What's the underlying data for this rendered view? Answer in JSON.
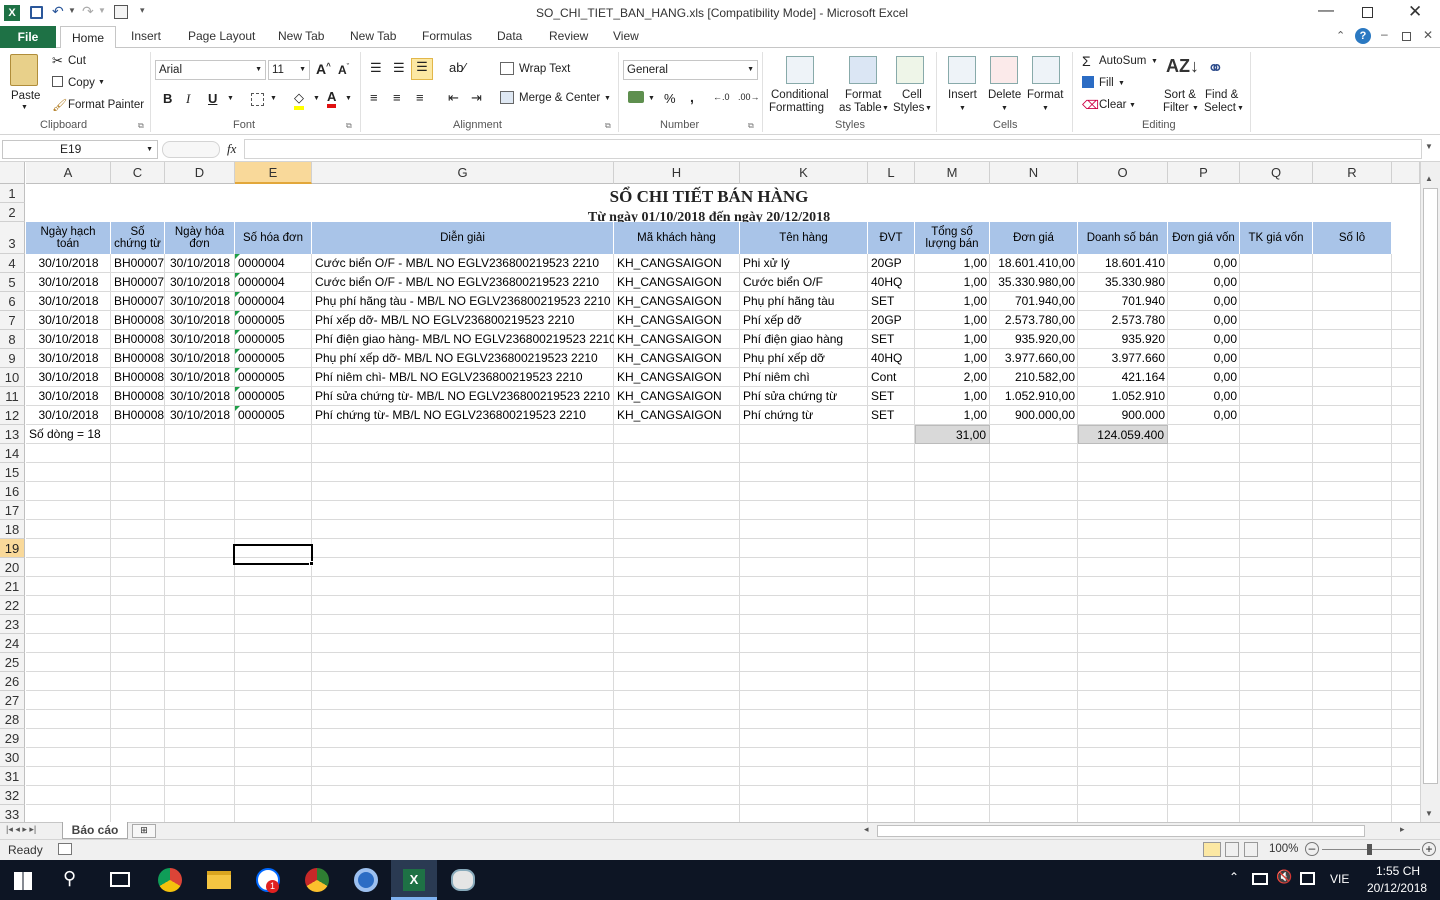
{
  "window": {
    "title": "SO_CHI_TIET_BAN_HANG.xls  [Compatibility Mode]  -  Microsoft Excel"
  },
  "tabs": [
    "File",
    "Home",
    "Insert",
    "Page Layout",
    "New Tab",
    "New Tab",
    "Formulas",
    "Data",
    "Review",
    "View"
  ],
  "ribbon": {
    "clipboard": {
      "label": "Clipboard",
      "paste": "Paste",
      "cut": "Cut",
      "copy": "Copy",
      "format_painter": "Format Painter"
    },
    "font": {
      "label": "Font",
      "name": "Arial",
      "size": "11"
    },
    "alignment": {
      "label": "Alignment",
      "wrap": "Wrap Text",
      "merge": "Merge & Center"
    },
    "number": {
      "label": "Number",
      "format": "General"
    },
    "styles": {
      "label": "Styles",
      "conditional1": "Conditional",
      "conditional2": "Formatting",
      "fmt_table1": "Format",
      "fmt_table2": "as Table",
      "cell_styles1": "Cell",
      "cell_styles2": "Styles"
    },
    "cells": {
      "label": "Cells",
      "insert": "Insert",
      "delete": "Delete",
      "format": "Format"
    },
    "editing": {
      "label": "Editing",
      "autosum": "AutoSum",
      "fill": "Fill",
      "clear": "Clear",
      "sort1": "Sort &",
      "sort2": "Filter",
      "find1": "Find &",
      "find2": "Select"
    }
  },
  "formula_bar": {
    "name_box": "E19",
    "fx": "fx",
    "formula": ""
  },
  "columns": [
    "A",
    "C",
    "D",
    "E",
    "G",
    "H",
    "K",
    "L",
    "M",
    "N",
    "O",
    "P",
    "Q",
    "R"
  ],
  "sheet": {
    "title": "SỔ CHI TIẾT BÁN HÀNG",
    "subtitle": "Từ ngày 01/10/2018 đến ngày 20/12/2018",
    "headers": [
      "Ngày hạch toán",
      "Số chứng từ",
      "Ngày hóa đơn",
      "Số hóa đơn",
      "Diễn giải",
      "Mã khách hàng",
      "Tên hàng",
      "ĐVT",
      "Tổng số lượng bán",
      "Đơn giá",
      "Doanh số bán",
      "Đơn giá vốn",
      "TK giá vốn",
      "Số lô"
    ],
    "rows": [
      [
        "30/10/2018",
        "BH00007",
        "30/10/2018",
        "0000004",
        "Cước biển O/F - MB/L NO EGLV236800219523 2210",
        "KH_CANGSAIGON",
        "Phi xử lý",
        "20GP",
        "1,00",
        "18.601.410,00",
        "18.601.410",
        "0,00"
      ],
      [
        "30/10/2018",
        "BH00007",
        "30/10/2018",
        "0000004",
        "Cước biển O/F - MB/L NO EGLV236800219523 2210",
        "KH_CANGSAIGON",
        "Cước biển O/F",
        "40HQ",
        "1,00",
        "35.330.980,00",
        "35.330.980",
        "0,00"
      ],
      [
        "30/10/2018",
        "BH00007",
        "30/10/2018",
        "0000004",
        "Phụ phí hãng tàu - MB/L NO EGLV236800219523 2210",
        "KH_CANGSAIGON",
        "Phụ phí hãng tàu",
        "SET",
        "1,00",
        "701.940,00",
        "701.940",
        "0,00"
      ],
      [
        "30/10/2018",
        "BH00008",
        "30/10/2018",
        "0000005",
        "Phí xếp dỡ- MB/L NO EGLV236800219523 2210",
        "KH_CANGSAIGON",
        "Phí xếp dỡ",
        "20GP",
        "1,00",
        "2.573.780,00",
        "2.573.780",
        "0,00"
      ],
      [
        "30/10/2018",
        "BH00008",
        "30/10/2018",
        "0000005",
        "Phí điện giao hàng- MB/L NO EGLV236800219523 2210",
        "KH_CANGSAIGON",
        "Phí điện giao hàng",
        "SET",
        "1,00",
        "935.920,00",
        "935.920",
        "0,00"
      ],
      [
        "30/10/2018",
        "BH00008",
        "30/10/2018",
        "0000005",
        "Phụ phí xếp dỡ- MB/L NO EGLV236800219523 2210",
        "KH_CANGSAIGON",
        "Phụ phí xếp dỡ",
        "40HQ",
        "1,00",
        "3.977.660,00",
        "3.977.660",
        "0,00"
      ],
      [
        "30/10/2018",
        "BH00008",
        "30/10/2018",
        "0000005",
        "Phí niêm chì- MB/L NO EGLV236800219523 2210",
        "KH_CANGSAIGON",
        "Phí niêm chì",
        "Cont",
        "2,00",
        "210.582,00",
        "421.164",
        "0,00"
      ],
      [
        "30/10/2018",
        "BH00008",
        "30/10/2018",
        "0000005",
        "Phí sửa chứng từ- MB/L NO EGLV236800219523 2210",
        "KH_CANGSAIGON",
        "Phí sửa chứng từ",
        "SET",
        "1,00",
        "1.052.910,00",
        "1.052.910",
        "0,00"
      ],
      [
        "30/10/2018",
        "BH00008",
        "30/10/2018",
        "0000005",
        "Phí chứng từ- MB/L NO EGLV236800219523 2210",
        "KH_CANGSAIGON",
        "Phí chứng từ",
        "SET",
        "1,00",
        "900.000,00",
        "900.000",
        "0,00"
      ]
    ],
    "total_label": "Số dòng = 18",
    "total_qty": "31,00",
    "total_sales": "124.059.400"
  },
  "sheet_tab": "Báo cáo",
  "status": {
    "ready": "Ready",
    "zoom": "100%"
  },
  "taskbar": {
    "lang": "VIE",
    "time": "1:55 CH",
    "date": "20/12/2018",
    "zalo_badge": "1"
  },
  "colors": {
    "excel_green": "#1e7145",
    "header_blue": "#a9c4e8",
    "total_fill": "#d9d9d9"
  }
}
